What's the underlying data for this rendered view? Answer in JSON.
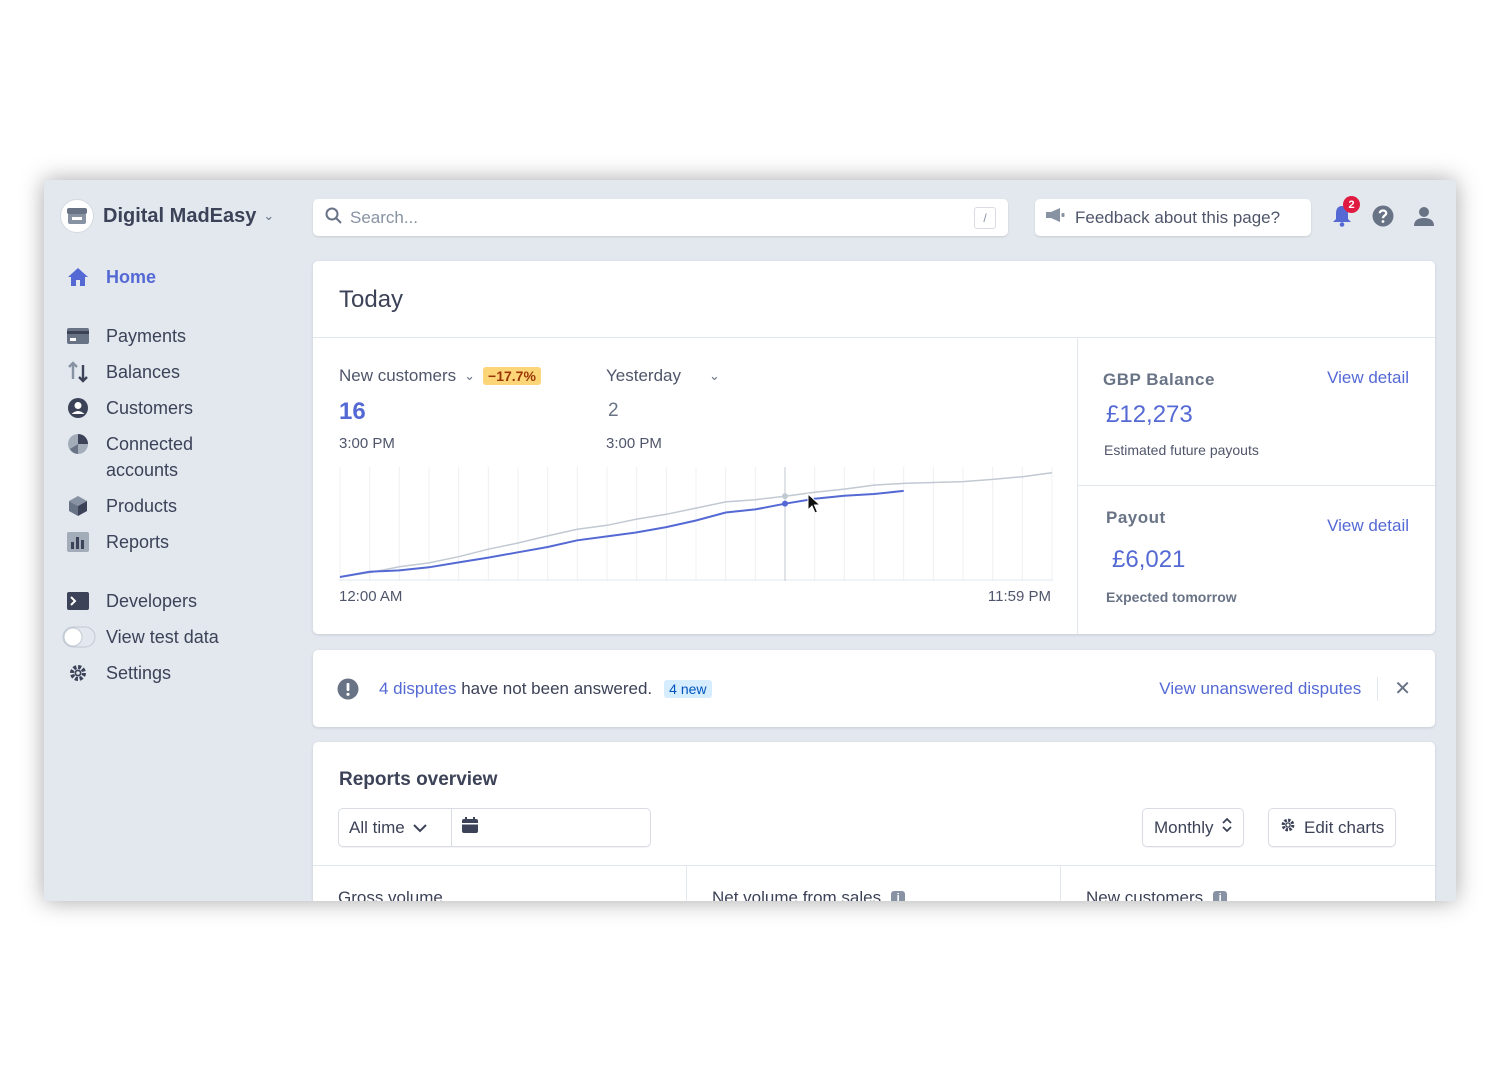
{
  "brand": {
    "name": "Digital MadEasy"
  },
  "search": {
    "placeholder": "Search...",
    "shortcut": "/"
  },
  "feedback": {
    "label": "Feedback about this page?"
  },
  "notifications": {
    "count": "2"
  },
  "sidebar": {
    "items": [
      {
        "label": "Home",
        "icon": "home-icon",
        "active": true
      },
      {
        "label": "Payments",
        "icon": "payments-icon"
      },
      {
        "label": "Balances",
        "icon": "balances-icon"
      },
      {
        "label": "Customers",
        "icon": "customers-icon"
      },
      {
        "label": "Connected accounts",
        "icon": "connected-accounts-icon"
      },
      {
        "label": "Products",
        "icon": "products-icon"
      },
      {
        "label": "Reports",
        "icon": "reports-icon"
      },
      {
        "label": "Developers",
        "icon": "developers-icon"
      },
      {
        "label": "View test data",
        "icon": "toggle-switch"
      },
      {
        "label": "Settings",
        "icon": "gear-icon"
      }
    ]
  },
  "today": {
    "title": "Today",
    "metric": {
      "label": "New customers",
      "delta": "−17.7%",
      "value": "16",
      "time": "3:00 PM"
    },
    "compare": {
      "label": "Yesterday",
      "value": "2",
      "time": "3:00 PM"
    },
    "chart_start": "12:00 AM",
    "chart_end": "11:59 PM"
  },
  "chart_data": {
    "type": "line",
    "x": [
      "12:00 AM",
      "1 AM",
      "2 AM",
      "3 AM",
      "4 AM",
      "5 AM",
      "6 AM",
      "7 AM",
      "8 AM",
      "9 AM",
      "10 AM",
      "11 AM",
      "12 PM",
      "1 PM",
      "2 PM",
      "3 PM",
      "4 PM",
      "5 PM",
      "6 PM",
      "7 PM",
      "8 PM",
      "9 PM",
      "10 PM",
      "11 PM",
      "11:59 PM"
    ],
    "series": [
      {
        "color": "#5469d4",
        "values": [
          0,
          1.2,
          1.5,
          2.2,
          3.3,
          4.4,
          5.6,
          6.8,
          8.3,
          9.2,
          10.1,
          11.3,
          12.8,
          14.6,
          15.3,
          16.6,
          17.7,
          18.4,
          18.8,
          19.5,
          null,
          null,
          null,
          null,
          null
        ]
      },
      {
        "color": "#c1c9d2",
        "values": [
          0,
          1,
          2.3,
          3.2,
          4.6,
          6.3,
          7.7,
          9.3,
          10.8,
          11.7,
          13.1,
          14.2,
          15.6,
          17,
          17.5,
          18.3,
          19.2,
          19.9,
          20.8,
          21.2,
          21.4,
          21.6,
          22.1,
          22.7,
          23.6
        ]
      }
    ],
    "ylim": [
      0,
      24
    ],
    "grid": true,
    "hover_index": 15
  },
  "gbp_balance": {
    "title": "GBP Balance",
    "link": "View detail",
    "amount": "£12,273",
    "sub": "Estimated future payouts"
  },
  "payout": {
    "title": "Payout",
    "link": "View detail",
    "amount": "£6,021",
    "sub": "Expected tomorrow"
  },
  "disputes": {
    "link": "4 disputes",
    "text": " have not been answered.",
    "badge": "4 new",
    "action": "View unanswered disputes"
  },
  "reports": {
    "title": "Reports overview",
    "range": "All time",
    "interval": "Monthly",
    "edit": "Edit charts",
    "columns": [
      "Gross volume",
      "Net volume from sales",
      "New customers"
    ]
  }
}
